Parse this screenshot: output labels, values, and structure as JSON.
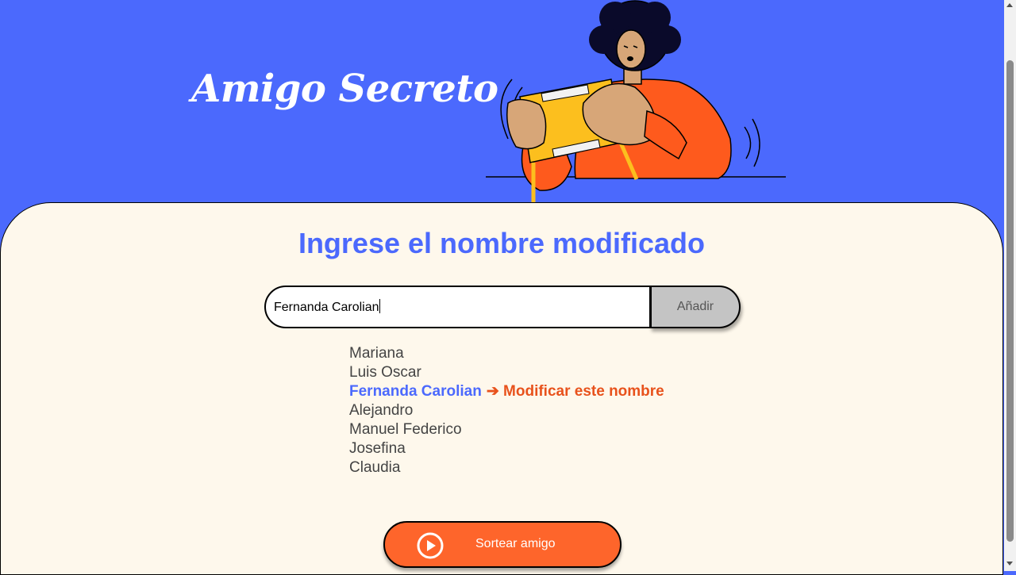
{
  "header": {
    "title": "Amigo Secreto"
  },
  "main": {
    "section_title": "Ingrese el nombre modificado",
    "input_value": "Fernanda Carolian",
    "add_button_label": "Añadir",
    "friends": [
      {
        "name": "Mariana"
      },
      {
        "name": "Luis Oscar"
      },
      {
        "name": "Fernanda Carolian",
        "action": "➔ Modificar este nombre"
      },
      {
        "name": "Alejandro"
      },
      {
        "name": "Manuel Federico"
      },
      {
        "name": "Josefina"
      },
      {
        "name": "Claudia"
      }
    ],
    "draw_button_label": "Sortear amigo",
    "draw_button_icon": "play-circle-icon"
  },
  "colors": {
    "primary_blue": "#4b69fd",
    "panel_bg": "#fef8ec",
    "accent_orange": "#fe652b",
    "modify_orange": "#e8521c",
    "button_gray": "#c4c4c4"
  }
}
